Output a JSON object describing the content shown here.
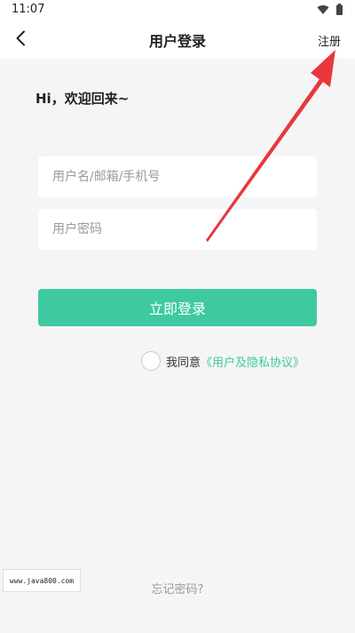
{
  "status_bar": {
    "time": "11:07",
    "icons": [
      "wifi-icon",
      "battery-icon"
    ]
  },
  "nav": {
    "back_icon": "chevron-left-icon",
    "title": "用户登录",
    "register_label": "注册"
  },
  "greeting": "Hi，欢迎回来~",
  "form": {
    "username_placeholder": "用户名/邮箱/手机号",
    "password_placeholder": "用户密码",
    "login_label": "立即登录"
  },
  "agreement": {
    "prefix": "我同意",
    "link_text": "《用户及隐私协议》"
  },
  "forgot_label": "忘记密码?",
  "watermark": "www.java800.com",
  "colors": {
    "accent": "#3ec9a0",
    "annotation_arrow": "#e8373a",
    "background": "#f5f5f5"
  }
}
